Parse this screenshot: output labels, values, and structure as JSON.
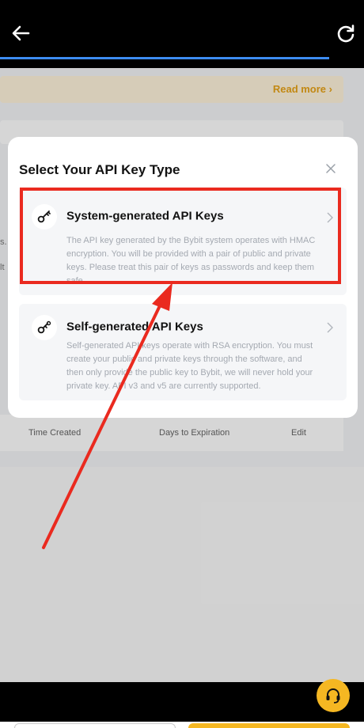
{
  "header": {
    "back_icon": "arrow-left-icon",
    "refresh_icon": "refresh-icon"
  },
  "page": {
    "banner_link": "Read more",
    "side_fragments": [
      "s.",
      "lt"
    ],
    "table_columns": [
      "Time Created",
      "Days to Expiration",
      "Edit"
    ]
  },
  "modal": {
    "title": "Select Your API Key Type",
    "options": [
      {
        "title": "System-generated API Keys",
        "description": "The API key generated by the Bybit system operates with HMAC encryption. You will be provided with a pair of public and private keys. Please treat this pair of keys as passwords and keep them safe.",
        "icon": "key-icon"
      },
      {
        "title": "Self-generated API Keys",
        "description": "Self-generated API keys operate with RSA encryption. You must create your public and private keys through the software, and then only provide the public key to Bybit, we will never hold your private key. API v3 and v5 are currently supported.",
        "icon": "custom-key-icon"
      }
    ]
  },
  "support_icon": "headset-icon",
  "colors": {
    "accent": "#f5b722",
    "annotation": "#ea2a1f",
    "link": "#e8a317"
  }
}
